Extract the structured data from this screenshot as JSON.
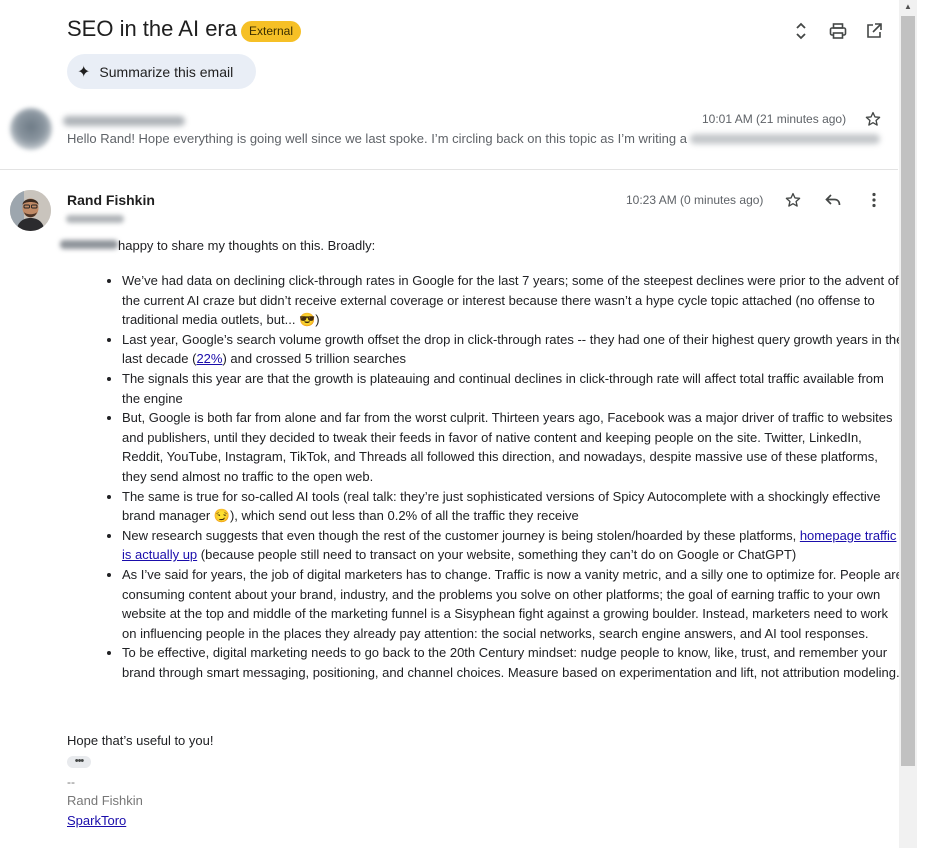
{
  "header": {
    "subject": "SEO in the AI era",
    "badge": "External",
    "summarize_label": "Summarize this email",
    "icons": [
      "expand-collapse-icon",
      "print-icon",
      "open-in-new-window-icon"
    ]
  },
  "collapsed_message": {
    "time": "10:01 AM (21 minutes ago)",
    "snippet": "Hello Rand! Hope everything is going well since we last spoke. I’m circling back on this topic as I’m writing a"
  },
  "message": {
    "sender": "Rand Fishkin",
    "time": "10:23 AM (0 minutes ago)",
    "intro": "happy to share my thoughts on this. Broadly:",
    "bullets": {
      "b1": "We’ve had data on declining click-through rates in Google for the last 7 years; some of the steepest declines were prior to the advent of the current AI craze but didn’t receive external coverage or interest because there wasn’t a hype cycle topic attached (no offense to traditional media outlets, but... 😎)",
      "b2_pre": "Last year, Google’s search volume growth offset the drop in click-through rates -- they had one of their highest query growth years in the last decade (",
      "b2_link": "22%",
      "b2_post": ") and crossed 5 trillion searches",
      "b3": "The signals this year are that the growth is plateauing and continual declines in click-through rate will affect total traffic available from the engine",
      "b4": "But, Google is both far from alone and far from the worst culprit. Thirteen years ago, Facebook was a major driver of traffic to websites and publishers, until they decided to tweak their feeds in favor of native content and keeping people on the site. Twitter, LinkedIn, Reddit, YouTube, Instagram, TikTok, and Threads all followed this direction, and nowadays, despite massive use of these platforms, they send almost no traffic to the open web.",
      "b5": "The same is true for so-called AI tools (real talk: they’re just sophisticated versions of Spicy Autocomplete with a shockingly effective brand manager 😏), which send out less than 0.2% of all the traffic they receive",
      "b6_pre": "New research suggests that even though the rest of the customer journey is being stolen/hoarded by these platforms, ",
      "b6_link": "homepage traffic is actually up",
      "b6_post": " (because people still need to transact on your website, something they can’t do on Google or ChatGPT)",
      "b7": "As I’ve said for years, the job of digital marketers has to change. Traffic is now a vanity metric, and a silly one to optimize for. People are consuming content about your brand, industry, and the problems you solve on other platforms; the goal of earning traffic to your own website at the top and middle of the marketing funnel is a Sisyphean fight against a growing boulder. Instead, marketers need to work on influencing people in the places they already pay attention: the social networks, search engine answers, and AI tool responses.",
      "b8": "To be effective, digital marketing needs to go back to the 20th Century mindset: nudge people to know, like, trust, and remember your brand through smart messaging, positioning, and channel choices. Measure based on experimentation and lift, not attribution modeling."
    },
    "closing": "Hope that’s useful to you!",
    "ellipsis": "•••",
    "signature": {
      "dash": "--",
      "name": "Rand Fishkin",
      "link": "SparkToro"
    }
  }
}
